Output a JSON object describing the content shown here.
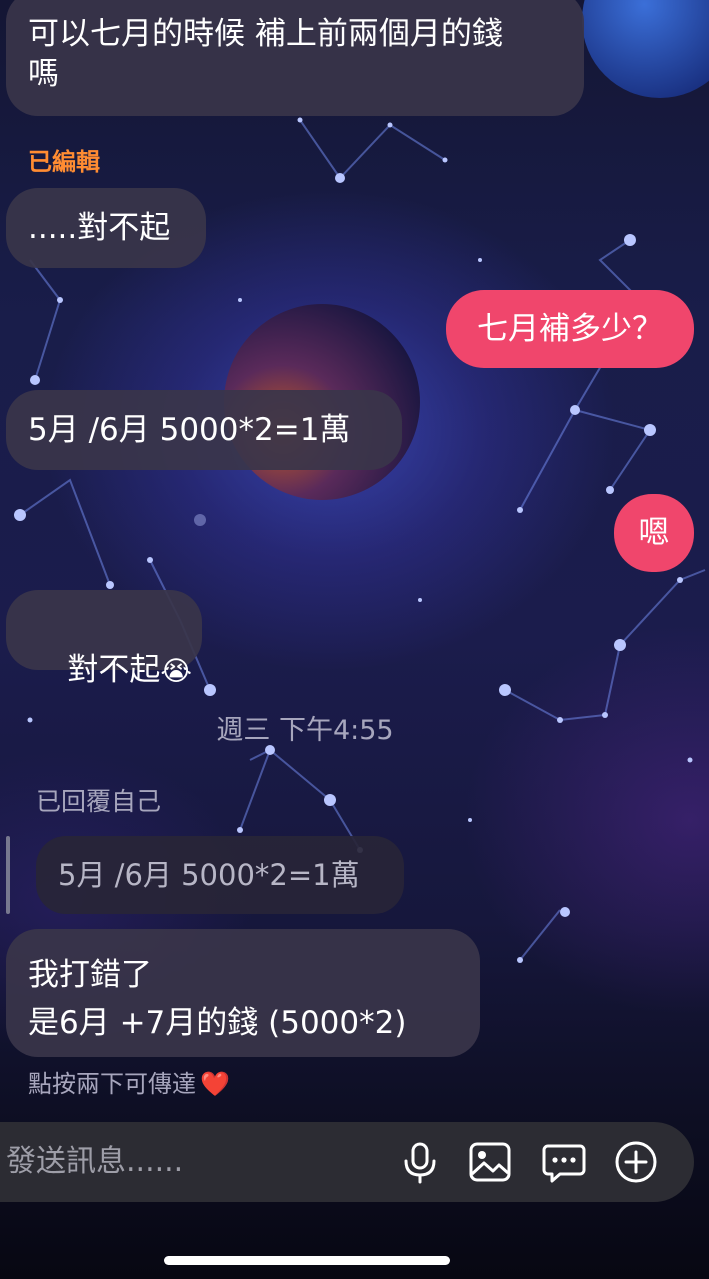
{
  "messages": {
    "m1": "可以七月的時候 補上前兩個月的錢\n嗎",
    "edited_label": "已編輯",
    "m2": ".....對不起",
    "m3_out": "七月補多少？",
    "m4": "5月 /6月 5000*2=1萬",
    "m5_out": "嗯",
    "m6_text": "對不起",
    "m6_emoji": "😭",
    "timestamp": "週三 下午4:55",
    "replied_label": "已回覆自己",
    "quoted": "5月 /6月 5000*2=1萬",
    "m7": "我打錯了\n是6月 +7月的錢 (5000*2)",
    "double_tap_hint": "點按兩下可傳達",
    "heart": "❤️"
  },
  "composer": {
    "placeholder": "發送訊息......",
    "icons": [
      "microphone-icon",
      "image-icon",
      "sticker-chat-icon",
      "plus-icon"
    ]
  },
  "colors": {
    "outgoing_bubble": "#f0466c",
    "incoming_bubble": "#3a354a",
    "edited_label": "#ff8c32",
    "meta_text": "#a7a6bd"
  }
}
